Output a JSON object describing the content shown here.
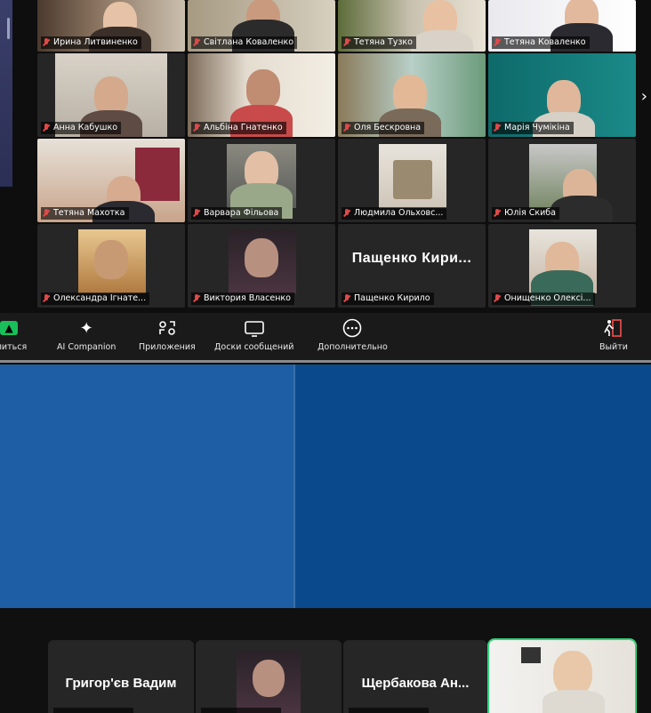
{
  "meeting": {
    "tiles": [
      {
        "name": "Ирина Литвиненко"
      },
      {
        "name": "Світлана Коваленко"
      },
      {
        "name": "Тетяна Тузко"
      },
      {
        "name": "Тетяна Коваленко"
      },
      {
        "name": "Анна Кабушко"
      },
      {
        "name": "Альбіна Гнатенко"
      },
      {
        "name": "Оля Бескровна"
      },
      {
        "name": "Марія Чумікіна"
      },
      {
        "name": "Тетяна Махотка"
      },
      {
        "name": "Варвара Фільова"
      },
      {
        "name": "Людмила Ольховс..."
      },
      {
        "name": "Юлія Скиба"
      },
      {
        "name": "Олександра Ігнате..."
      },
      {
        "name": "Виктория Власенко"
      },
      {
        "name": "Пащенко Кирило",
        "display_name": "Пащенко Кири..."
      },
      {
        "name": "Онищенко Олексі..."
      }
    ],
    "next_page_icon": "chevron-right-icon"
  },
  "toolbar": {
    "share_label": "елиться",
    "companion_label": "AI Companion",
    "apps_label": "Приложения",
    "boards_label": "Доски сообщений",
    "more_label": "Дополнительно",
    "leave_label": "Выйти",
    "accent": "#19c05a"
  },
  "bottom_strip": {
    "tiles": [
      {
        "display_name": "Григор'єв Вадим"
      },
      {
        "display_name": ""
      },
      {
        "display_name": "Щербакова Ан..."
      },
      {
        "display_name": ""
      }
    ],
    "active_border": "#2fd67a"
  },
  "colors": {
    "blue_left": "#1d5ea4",
    "blue_right": "#0a4a8c"
  }
}
